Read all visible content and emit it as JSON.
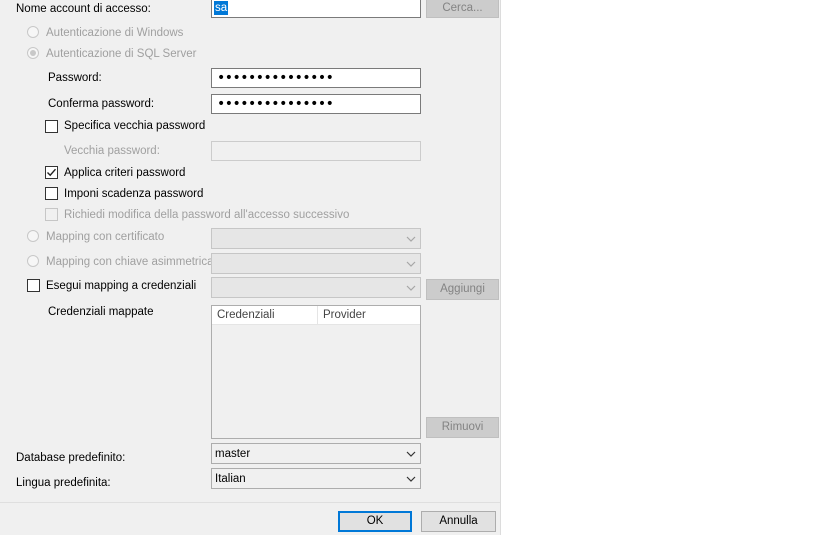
{
  "login": {
    "name_label": "Nome account di accesso:",
    "name_value": "sa",
    "browse_button": "Cerca..."
  },
  "auth": {
    "windows_label": "Autenticazione di Windows",
    "sql_label": "Autenticazione di SQL Server"
  },
  "password": {
    "label": "Password:",
    "value": "•••••••••••••••",
    "confirm_label": "Conferma password:",
    "confirm_value": "•••••••••••••••",
    "specify_old_label": "Specifica vecchia password",
    "old_label": "Vecchia password:",
    "enforce_policy_label": "Applica criteri password",
    "enforce_expiration_label": "Imponi scadenza password",
    "must_change_label": "Richiedi modifica della password all'accesso successivo"
  },
  "mapping": {
    "certificate_label": "Mapping con certificato",
    "asymmetric_label": "Mapping con chiave asimmetrica",
    "credential_label": "Esegui mapping a credenziali",
    "add_button": "Aggiungi",
    "mapped_label": "Credenziali mappate",
    "columns": [
      "Credenziali",
      "Provider"
    ],
    "remove_button": "Rimuovi"
  },
  "defaults": {
    "database_label": "Database predefinito:",
    "database_value": "master",
    "language_label": "Lingua predefinita:",
    "language_value": "Italian"
  },
  "buttons": {
    "ok": "OK",
    "cancel": "Annulla"
  },
  "state": {
    "auth_sql_selected": true,
    "specify_old_checked": false,
    "enforce_policy_checked": true,
    "enforce_expiration_checked": false,
    "must_change_checked": false,
    "map_credential_checked": false
  },
  "colors": {
    "panel_bg": "#f0f0f0",
    "selection": "#0078d7",
    "disabled_text": "#a0a0a0"
  }
}
